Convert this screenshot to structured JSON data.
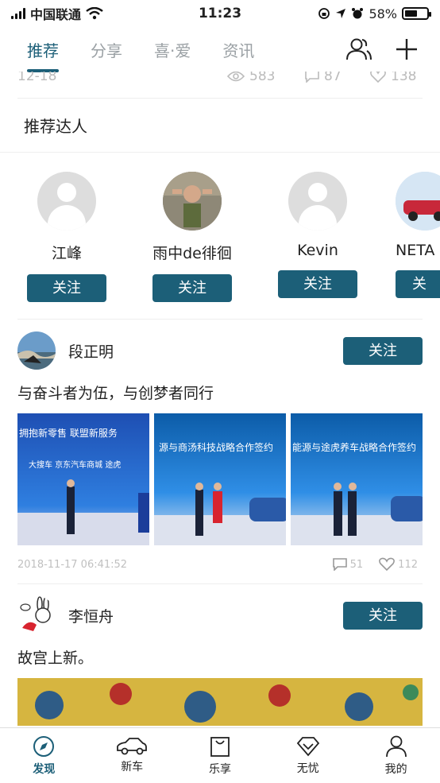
{
  "status_bar": {
    "carrier": "中国联通",
    "time": "11:23",
    "battery": "58%",
    "battery_level": 0.58
  },
  "top_tabs": [
    {
      "label": "推荐",
      "active": true
    },
    {
      "label": "分享",
      "active": false
    },
    {
      "label": "喜·爱",
      "active": false
    },
    {
      "label": "资讯",
      "active": false
    }
  ],
  "peek_row": {
    "date": "12-18",
    "views": "583",
    "comments": "87",
    "likes": "138"
  },
  "recommended": {
    "title": "推荐达人",
    "experts": [
      {
        "name": "江峰",
        "follow_label": "关注"
      },
      {
        "name": "雨中de徘徊",
        "follow_label": "关注"
      },
      {
        "name": "Kevin",
        "follow_label": "关注"
      },
      {
        "name": "NETA",
        "follow_label": "关"
      }
    ]
  },
  "posts": [
    {
      "author": "段正明",
      "follow_label": "关注",
      "text": "与奋斗者为伍，与创梦者同行",
      "images": [
        {
          "banner": "拥抱新零售  联盟新服务",
          "sub": "大搜车   京东汽车商城   途虎"
        },
        {
          "banner": "源与商汤科技战略合作签约",
          "sub": ""
        },
        {
          "banner": "能源与途虎养车战略合作签约",
          "sub": ""
        }
      ],
      "timestamp": "2018-11-17 06:41:52",
      "comments": "51",
      "likes": "112"
    },
    {
      "author": "李恒舟",
      "follow_label": "关注",
      "text": "故宫上新。"
    }
  ],
  "bottom_nav": [
    {
      "label": "发现",
      "icon": "compass-icon",
      "active": true
    },
    {
      "label": "新车",
      "icon": "car-icon",
      "active": false
    },
    {
      "label": "乐享",
      "icon": "bag-icon",
      "active": false
    },
    {
      "label": "无忧",
      "icon": "diamond-icon",
      "active": false
    },
    {
      "label": "我的",
      "icon": "person-icon",
      "active": false
    }
  ],
  "colors": {
    "accent": "#1c5f78"
  }
}
